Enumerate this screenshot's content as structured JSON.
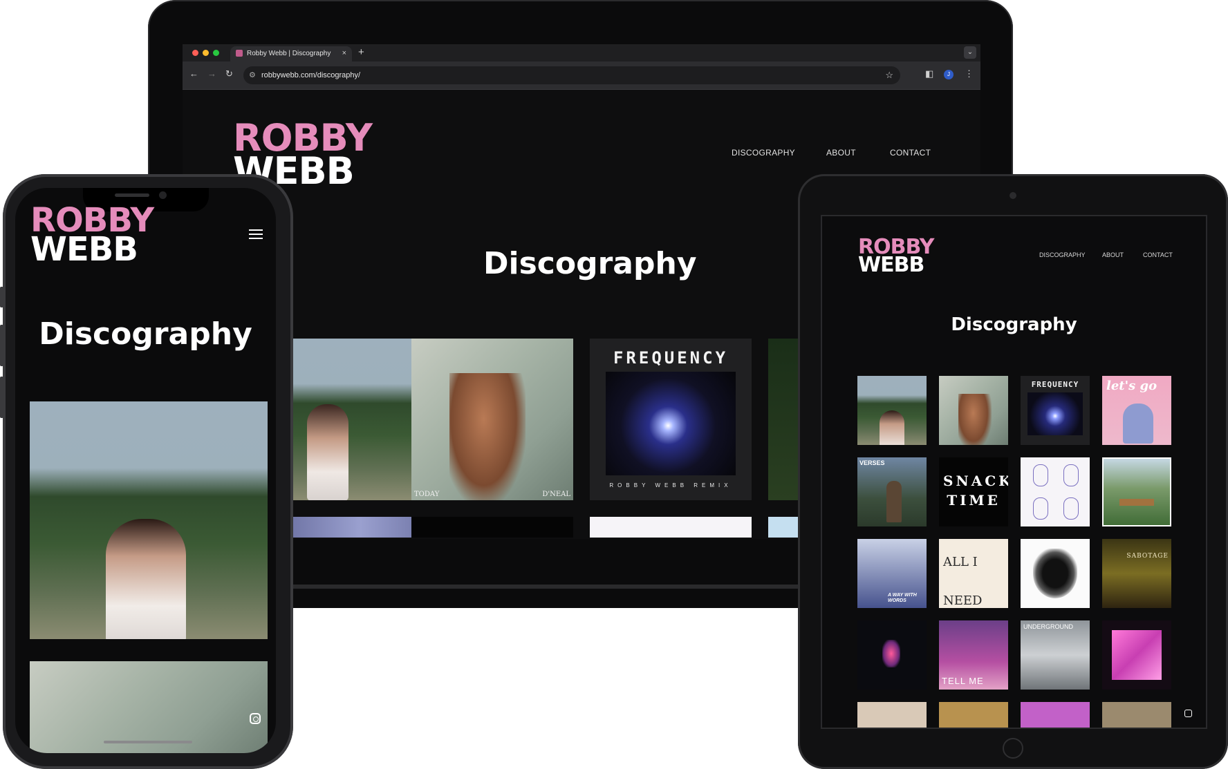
{
  "browser": {
    "tab_title": "Robby Webb | Discography",
    "tab_close": "×",
    "new_tab": "+",
    "url": "robbywebb.com/discography/",
    "profile_initial": "J"
  },
  "site": {
    "logo_line1": "ROBBY",
    "logo_line2": "WEBB",
    "nav": [
      "DISCOGRAPHY",
      "ABOUT",
      "CONTACT"
    ],
    "page_title": "Discography",
    "brand_colors": {
      "pink": "#e58cbb",
      "background": "#0e0e0f"
    }
  },
  "albums": {
    "today_left": "TODAY",
    "today_right": "D'NEAL",
    "frequency_title": "FREQUENCY",
    "frequency_sub": "ROBBY WEBB REMIX",
    "lets_go": "let's go",
    "verses": "VERSES",
    "snack_time": "SNACK TIME",
    "all_i_need": "ALL I NEED",
    "a_way_with_words": "A WAY WITH WORDS",
    "sabotage": "SABOTAGE",
    "tell_me": "TELL ME",
    "underground": "UNDERGROUND"
  },
  "icons": {
    "hamburger": "menu-icon",
    "instagram": "instagram-icon"
  }
}
